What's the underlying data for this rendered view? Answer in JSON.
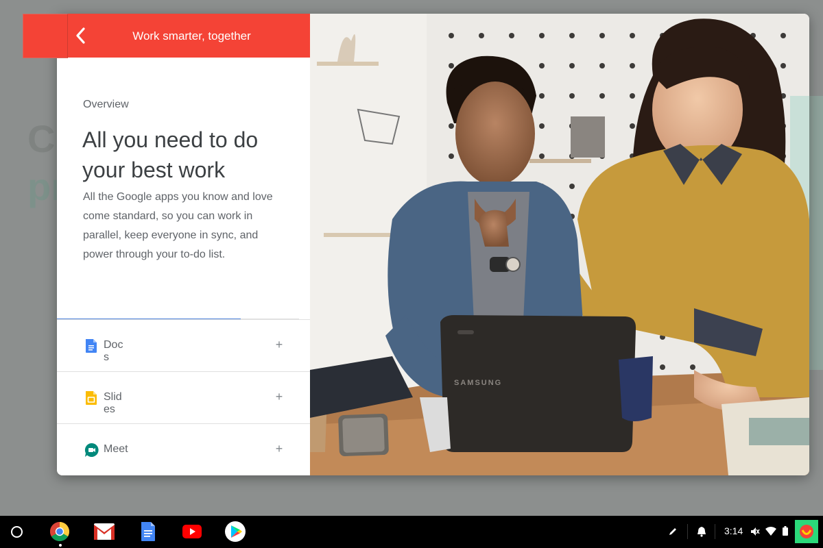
{
  "dialog": {
    "header_title": "Work smarter, together",
    "overview_label": "Overview",
    "headline": "All you need to do your best work",
    "body": "All the Google apps you know and love come standard, so you can work in parallel, keep everyone in sync, and power through your to-do list.",
    "progress_fraction": 0.76,
    "apps": [
      {
        "label": "Docs",
        "icon": "docs-icon",
        "action": "+"
      },
      {
        "label": "Slides",
        "icon": "slides-icon",
        "action": "+"
      },
      {
        "label": "Meet",
        "icon": "meet-icon",
        "action": "+"
      }
    ]
  },
  "photo": {
    "laptop_brand": "SAMSUNG"
  },
  "shelf": {
    "apps": [
      "chrome-icon",
      "gmail-icon",
      "docs-icon",
      "youtube-icon",
      "play-store-icon"
    ],
    "time": "3:14"
  },
  "colors": {
    "header": "#f44336",
    "progress": "#4a7fd8",
    "docs": "#4285f4",
    "slides": "#fbbc04",
    "meet": "#00897b"
  }
}
